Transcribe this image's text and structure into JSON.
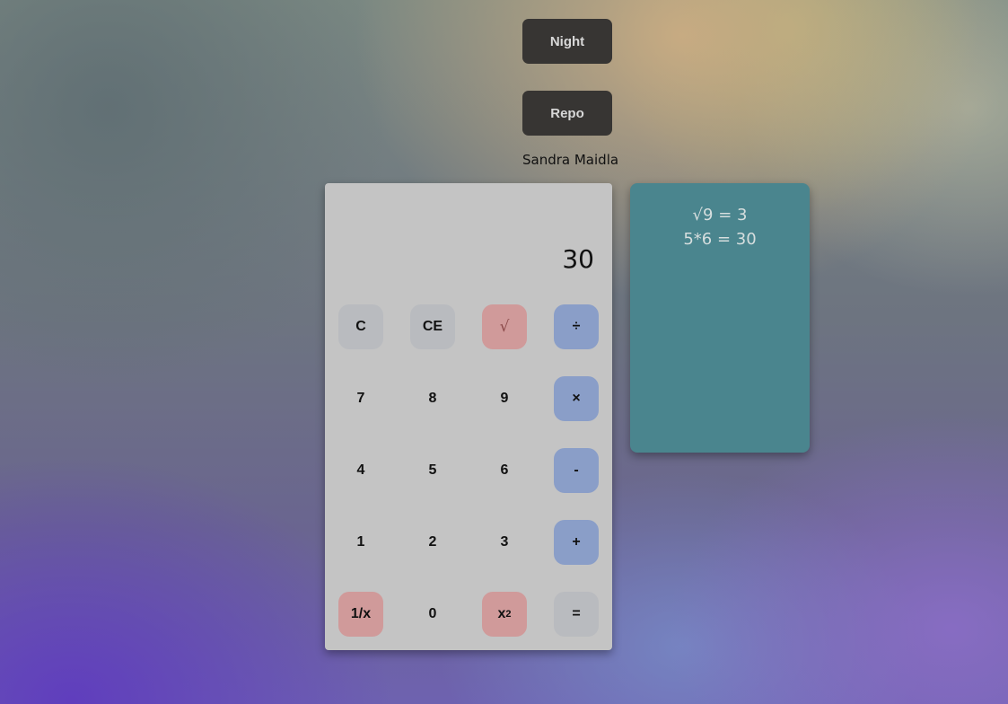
{
  "controls": {
    "night_label": "Night",
    "repo_label": "Repo",
    "author": "Sandra Maidla"
  },
  "calculator": {
    "display": "30",
    "keys": [
      {
        "label": "C",
        "style": "gray"
      },
      {
        "label": "CE",
        "style": "gray"
      },
      {
        "label": "√",
        "style": "red"
      },
      {
        "label": "÷",
        "style": "blue"
      },
      {
        "label": "7",
        "style": "plain"
      },
      {
        "label": "8",
        "style": "plain"
      },
      {
        "label": "9",
        "style": "plain"
      },
      {
        "label": "×",
        "style": "blue"
      },
      {
        "label": "4",
        "style": "plain"
      },
      {
        "label": "5",
        "style": "plain"
      },
      {
        "label": "6",
        "style": "plain"
      },
      {
        "label": "-",
        "style": "blue"
      },
      {
        "label": "1",
        "style": "plain"
      },
      {
        "label": "2",
        "style": "plain"
      },
      {
        "label": "3",
        "style": "plain"
      },
      {
        "label": "+",
        "style": "blue"
      },
      {
        "label": "1/x",
        "style": "red"
      },
      {
        "label": "0",
        "style": "plain"
      },
      {
        "label": "x",
        "sup": "2",
        "style": "red"
      },
      {
        "label": "=",
        "style": "gray"
      }
    ]
  },
  "history": {
    "entries": [
      "√9 = 3",
      "5*6 = 30"
    ]
  },
  "colors": {
    "button_dark": "#373533",
    "calculator_bg": "#c4c4c4",
    "key_gray": "#b9bbbf",
    "key_red": "#d09a9a",
    "key_blue": "#8a9ec8",
    "history_bg": "#4a858e"
  }
}
